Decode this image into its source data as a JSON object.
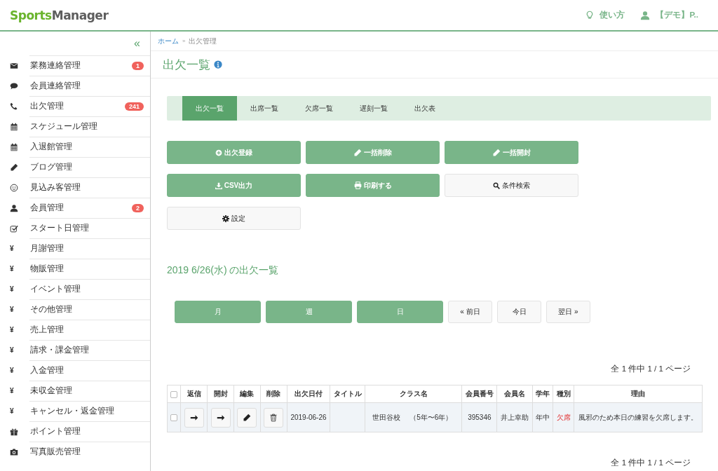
{
  "header": {
    "logo_part_1": "Sports",
    "logo_part_2": "Manager",
    "help_label": "使い方",
    "user_label": "【デモ】P.."
  },
  "sidebar": {
    "collapse": "«",
    "items": [
      {
        "label": "業務連絡管理",
        "badge": "1"
      },
      {
        "label": "会員連絡管理"
      },
      {
        "label": "出欠管理",
        "badge": "241"
      },
      {
        "label": "スケジュール管理"
      },
      {
        "label": "入退館管理"
      },
      {
        "label": "ブログ管理"
      },
      {
        "label": "見込み客管理"
      },
      {
        "label": "会員管理",
        "badge": "2"
      },
      {
        "label": "スタート日管理"
      },
      {
        "label": "月謝管理",
        "glyph": "¥"
      },
      {
        "label": "物販管理",
        "glyph": "¥"
      },
      {
        "label": "イベント管理",
        "glyph": "¥"
      },
      {
        "label": "その他管理",
        "glyph": "¥"
      },
      {
        "label": "売上管理",
        "glyph": "¥"
      },
      {
        "label": "請求・課金管理",
        "glyph": "¥"
      },
      {
        "label": "入金管理",
        "glyph": "¥"
      },
      {
        "label": "未収金管理",
        "glyph": "¥"
      },
      {
        "label": "キャンセル・返金管理",
        "glyph": "¥"
      },
      {
        "label": "ポイント管理"
      },
      {
        "label": "写真販売管理"
      }
    ]
  },
  "breadcrumb": {
    "home": "ホーム",
    "separator": "»",
    "current": "出欠管理"
  },
  "page_title": "出欠一覧",
  "tabs": [
    {
      "label": "出欠一覧",
      "selected": true
    },
    {
      "label": "出席一覧",
      "selected": false
    },
    {
      "label": "欠席一覧",
      "selected": false
    },
    {
      "label": "遅刻一覧",
      "selected": false
    },
    {
      "label": "出欠表",
      "selected": false
    }
  ],
  "actions": [
    {
      "label": "出欠登録",
      "kind": "primary"
    },
    {
      "label": "一括削除",
      "kind": "primary"
    },
    {
      "label": "一括開封",
      "kind": "primary"
    },
    {
      "label": "CSV出力",
      "kind": "primary"
    },
    {
      "label": "印刷する",
      "kind": "primary"
    },
    {
      "label": "条件検索",
      "kind": "default"
    },
    {
      "label": "設定",
      "kind": "default"
    }
  ],
  "date_heading": "2019 6/26(水) の出欠一覧",
  "calendar_buttons": [
    {
      "label": "月",
      "kind": "primary"
    },
    {
      "label": "週",
      "kind": "primary"
    },
    {
      "label": "日",
      "kind": "primary"
    },
    {
      "label": "« 前日",
      "kind": "default"
    },
    {
      "label": "今日",
      "kind": "default"
    },
    {
      "label": "翌日 »",
      "kind": "default"
    }
  ],
  "pagination_top": "全 1 件中 1 / 1 ページ",
  "table": {
    "select_all_checked": false,
    "columns": [
      "返信",
      "開封",
      "編集",
      "削除",
      "出欠日付",
      "タイトル",
      "クラス名",
      "会員番号",
      "会員名",
      "学年",
      "種別",
      "理由"
    ],
    "rows": [
      {
        "checked": false,
        "date": "2019-06-26",
        "class": "世田谷校　 （5年〜6年）",
        "member_no": "395346",
        "member_name": "井上幸助",
        "grade": "年中",
        "type": "欠席",
        "reason": "風邪のため本日の練習を欠席します。"
      }
    ]
  },
  "pagination_bottom": "全 1 件中 1 / 1 ページ"
}
